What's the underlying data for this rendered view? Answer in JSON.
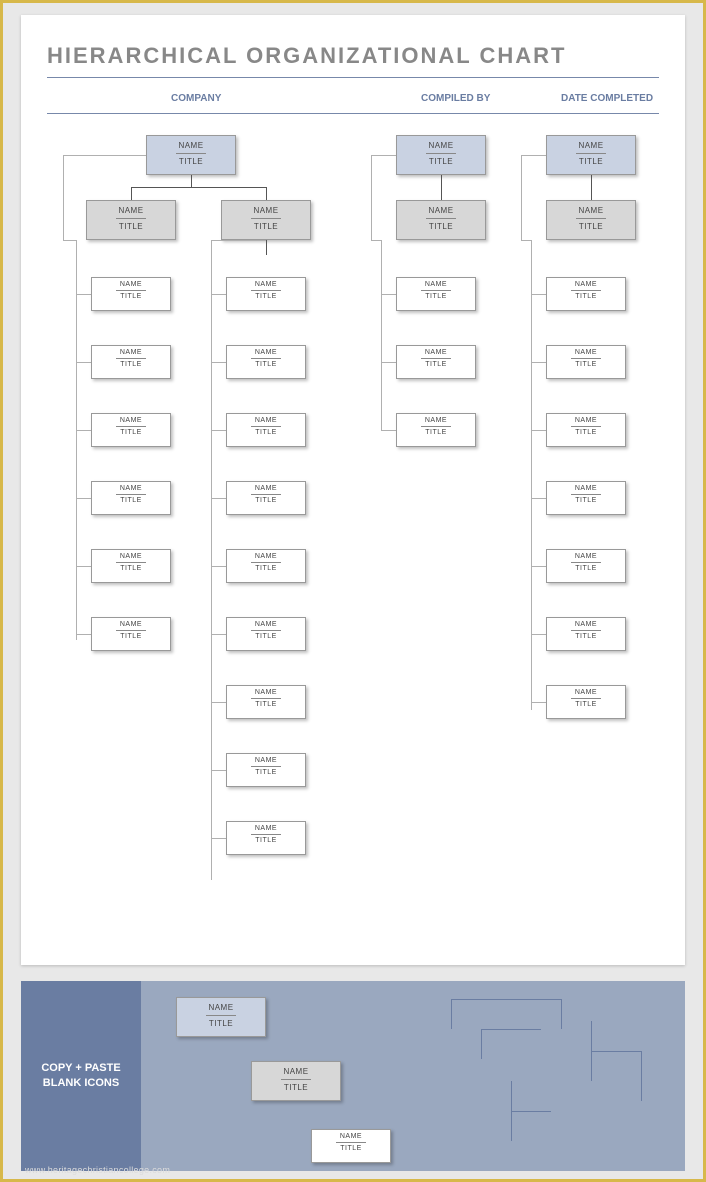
{
  "title": "HIERARCHICAL ORGANIZATIONAL CHART",
  "headers": {
    "company": "COMPANY",
    "compiled_by": "COMPILED BY",
    "date_completed": "DATE COMPLETED"
  },
  "node": {
    "name": "NAME",
    "title": "TITLE"
  },
  "panel2": {
    "side": "COPY + PASTE BLANK ICONS"
  },
  "watermark": "www.heritagechristiancollege.com",
  "structure": {
    "tops": 3,
    "managers_per_top": [
      2,
      1,
      1
    ],
    "leaves": {
      "branch1_mgrA": 6,
      "branch1_mgrB": 9,
      "branch2_mgr": 3,
      "branch3_mgr": 7
    }
  }
}
